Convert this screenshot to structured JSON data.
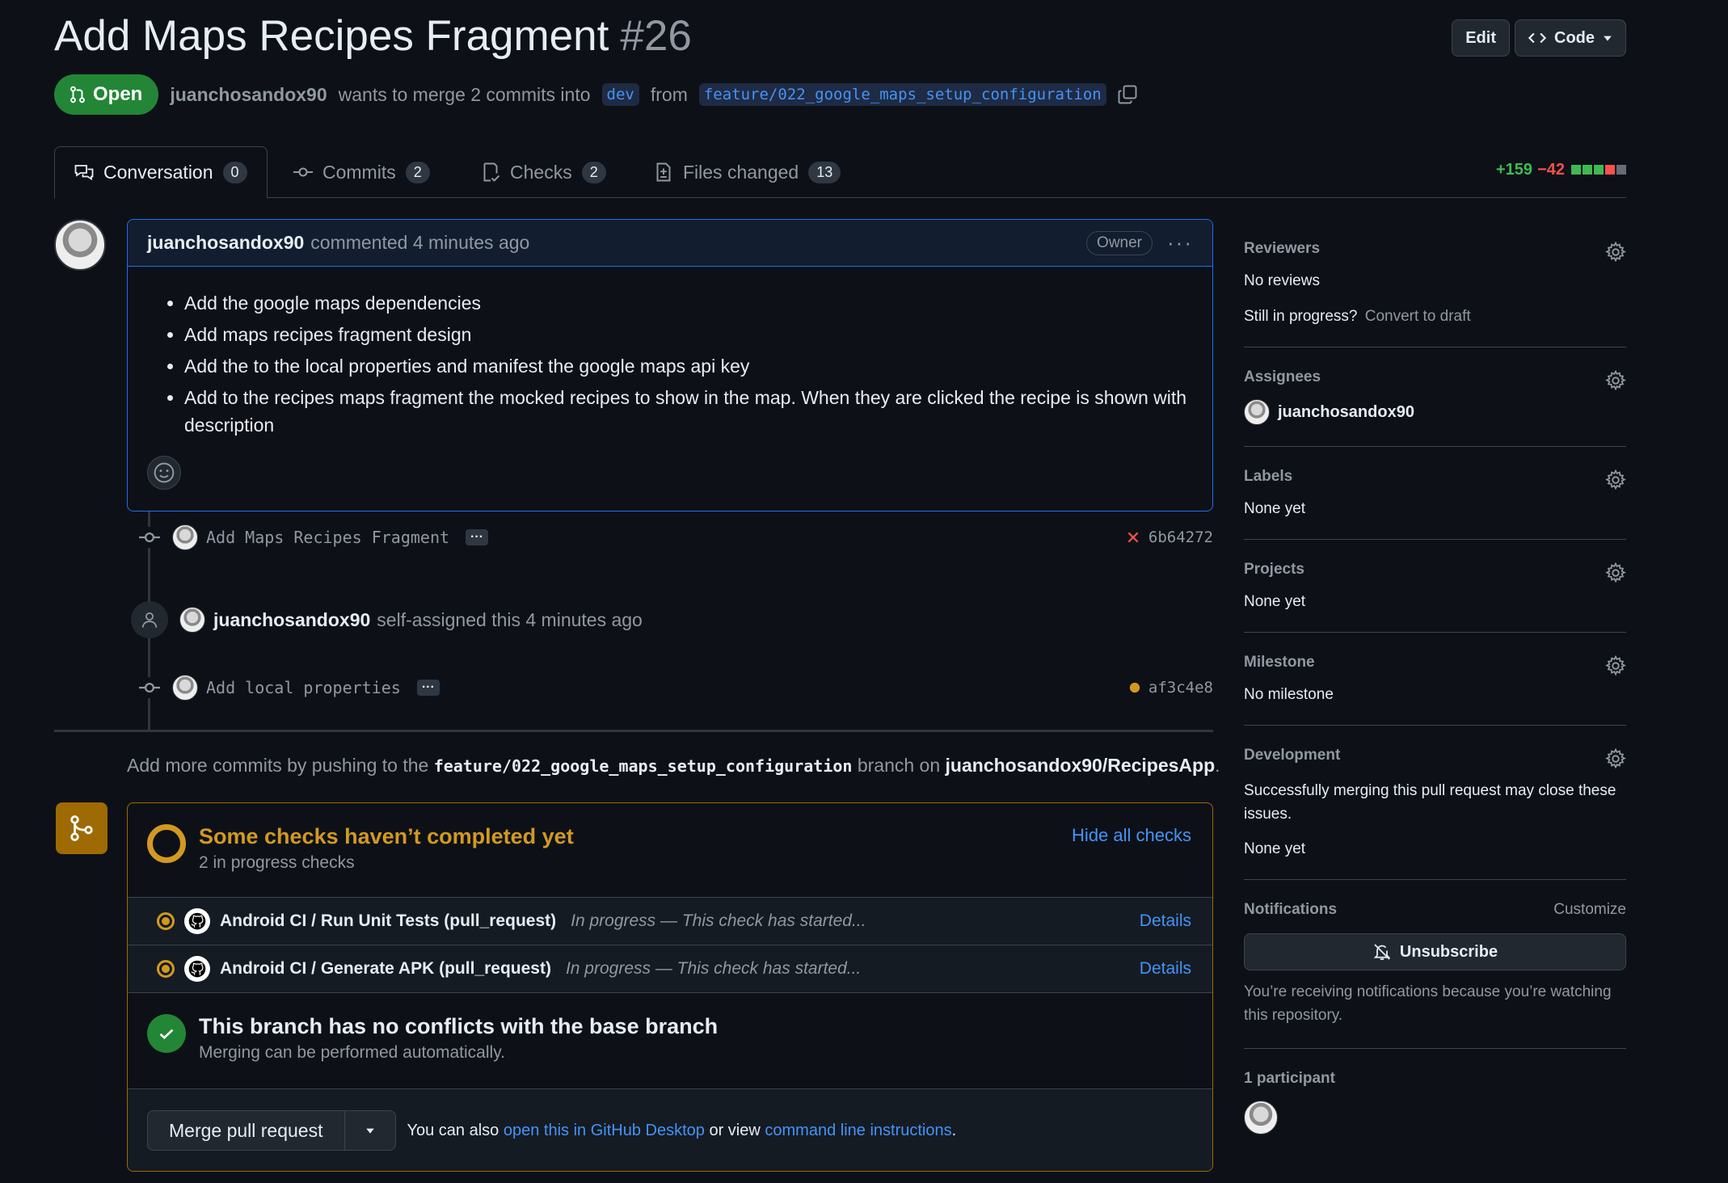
{
  "pr": {
    "title": "Add Maps Recipes Fragment",
    "number": "#26",
    "state": "Open",
    "author": "juanchosandox90",
    "merge_text": "wants to merge 2 commits into",
    "base_branch": "dev",
    "from_text": "from",
    "head_branch": "feature/022_google_maps_setup_configuration"
  },
  "header": {
    "edit_label": "Edit",
    "code_label": "Code"
  },
  "tabs": [
    {
      "label": "Conversation",
      "count": "0"
    },
    {
      "label": "Commits",
      "count": "2"
    },
    {
      "label": "Checks",
      "count": "2"
    },
    {
      "label": "Files changed",
      "count": "13"
    }
  ],
  "diffstat": {
    "additions": "+159",
    "deletions": "−42",
    "blocks": [
      "#3fb950",
      "#3fb950",
      "#3fb950",
      "#f85149",
      "#656c76"
    ]
  },
  "comment": {
    "author": "juanchosandox90",
    "meta": "commented 4 minutes ago",
    "badge": "Owner",
    "items": [
      "Add the google maps dependencies",
      "Add maps recipes fragment design",
      "Add the to the local properties and manifest the google maps api key",
      "Add to the recipes maps fragment the mocked recipes to show in the map. When they are clicked the recipe is shown with description"
    ]
  },
  "timeline": {
    "commit1": {
      "message": "Add Maps Recipes Fragment",
      "sha": "6b64272"
    },
    "event": {
      "actor": "juanchosandox90",
      "text": "self-assigned this 4 minutes ago"
    },
    "commit2": {
      "message": "Add local properties",
      "sha": "af3c4e8"
    }
  },
  "push_note": {
    "prefix": "Add more commits by pushing to the",
    "branch": "feature/022_google_maps_setup_configuration",
    "middle": "branch on",
    "repo": "juanchosandox90/RecipesApp",
    "suffix": "."
  },
  "checks": {
    "title": "Some checks haven’t completed yet",
    "subtitle": "2 in progress checks",
    "hide_label": "Hide all checks",
    "rows": [
      {
        "name": "Android CI / Run Unit Tests (pull_request)",
        "status": "In progress — This check has started...",
        "details": "Details"
      },
      {
        "name": "Android CI / Generate APK (pull_request)",
        "status": "In progress — This check has started...",
        "details": "Details"
      }
    ]
  },
  "conflicts": {
    "title": "This branch has no conflicts with the base branch",
    "subtitle": "Merging can be performed automatically."
  },
  "merge": {
    "button": "Merge pull request",
    "hint_prefix": "You can also",
    "desktop_link": "open this in GitHub Desktop",
    "hint_middle": "or view",
    "cli_link": "command line instructions",
    "hint_suffix": "."
  },
  "sidebar": {
    "reviewers": {
      "title": "Reviewers",
      "value": "No reviews",
      "progress_q": "Still in progress?",
      "draft_link": "Convert to draft"
    },
    "assignees": {
      "title": "Assignees",
      "value": "juanchosandox90"
    },
    "labels": {
      "title": "Labels",
      "value": "None yet"
    },
    "projects": {
      "title": "Projects",
      "value": "None yet"
    },
    "milestone": {
      "title": "Milestone",
      "value": "No milestone"
    },
    "development": {
      "title": "Development",
      "text": "Successfully merging this pull request may close these issues.",
      "value": "None yet"
    },
    "notifications": {
      "title": "Notifications",
      "customize": "Customize",
      "button": "Unsubscribe",
      "reason": "You’re receiving notifications because you’re watching this repository."
    },
    "participants": {
      "title": "1 participant"
    }
  }
}
